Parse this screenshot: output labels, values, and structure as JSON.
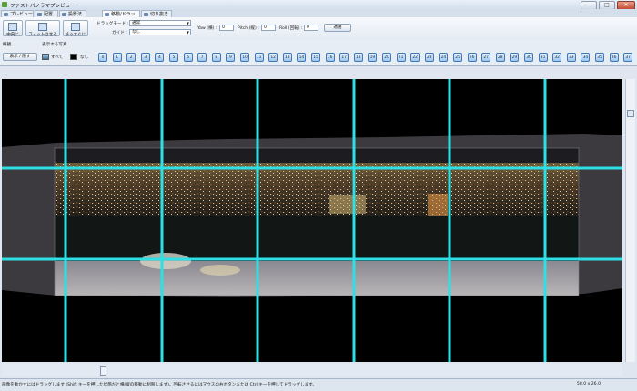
{
  "window": {
    "title": "ファストパノラマプレビュー",
    "min": "–",
    "max": "□",
    "close": "✕"
  },
  "tabs": [
    {
      "label": "プレビュー",
      "active": false
    },
    {
      "label": "配置",
      "active": false
    },
    {
      "label": "投影法",
      "active": false
    },
    {
      "label": "移動/ドラッグ",
      "active": true
    },
    {
      "label": "切り抜き",
      "active": false
    }
  ],
  "ribbon": {
    "center_label": "中央に",
    "fit_label": "フィットさせる",
    "straighten_label": "まっすぐに",
    "drag_mode_label": "ドラッグモード :",
    "drag_mode_value": "通常",
    "guide_label": "ガイド :",
    "guide_value": "なし",
    "yaw_label": "Yaw (横) :",
    "yaw_value": "0",
    "pitch_label": "Pitch (縦) :",
    "pitch_value": "0",
    "roll_label": "Roll (回転) :",
    "roll_value": "0",
    "apply_label": "適用"
  },
  "row2": {
    "outline_label": "概観",
    "images_label": "表示する写真",
    "show_hide_label": "表示 / 隠す",
    "all_label": "すべて",
    "none_label": "なし",
    "image_buttons": [
      "0",
      "1",
      "2",
      "3",
      "4",
      "5",
      "6",
      "7",
      "8",
      "9",
      "10",
      "11",
      "12",
      "13",
      "14",
      "15",
      "16",
      "17",
      "18",
      "19",
      "20",
      "21",
      "22",
      "23",
      "24",
      "25",
      "26",
      "27",
      "28",
      "29",
      "30",
      "31",
      "32",
      "33",
      "34",
      "35",
      "36",
      "37",
      "38"
    ]
  },
  "colors": {
    "guide_line": "#2ee0e6",
    "viewport_bg": "#000000",
    "button_accent": "#3d78b8"
  },
  "status": {
    "message": "画像を動かすにはドラッグします (Shift キーを押した状態だと横/縦の移動に制限します)。回転させるにはマウスの右ボタンまたは Ctrl キーを押してドラッグします。",
    "fov": "58.0 x 26.0"
  }
}
